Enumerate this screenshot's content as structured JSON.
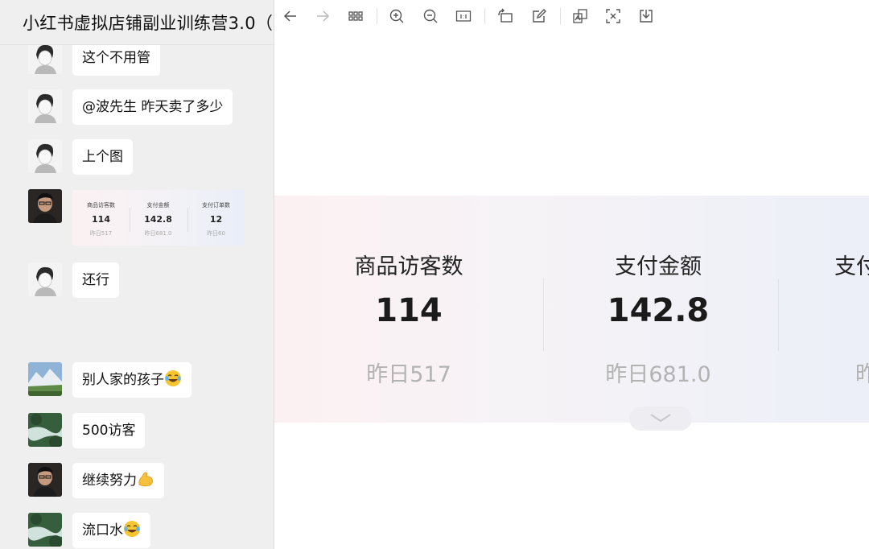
{
  "chat": {
    "title": "小红书虚拟店铺副业训练营3.0（",
    "messages": [
      {
        "text": "这个不用管",
        "avatar": "sketch-avatar"
      },
      {
        "text": "@波先生 昨天卖了多少",
        "avatar": "sketch-avatar"
      },
      {
        "text": "上个图",
        "avatar": "sketch-avatar"
      },
      {
        "text": "还行",
        "avatar": "sketch-avatar"
      },
      {
        "text": "别人家的孩子",
        "emoji": "tears-of-joy-emoji",
        "avatar": "mountain-avatar"
      },
      {
        "text": "500访客",
        "avatar": "river-avatar"
      },
      {
        "text": "继续努力",
        "emoji": "flexed-biceps-emoji",
        "avatar": "photo-avatar"
      },
      {
        "text": "流口水",
        "emoji": "tears-of-joy-emoji",
        "avatar": "river-avatar"
      }
    ],
    "image_message": {
      "avatar": "photo-avatar",
      "stats": [
        {
          "label": "商品访客数",
          "value": "114",
          "sub": "昨日517"
        },
        {
          "label": "支付金额",
          "value": "142.8",
          "sub": "昨日681.0"
        },
        {
          "label": "支付订单数",
          "value": "12",
          "sub": "昨日60"
        }
      ]
    }
  },
  "viewer": {
    "toolbar": [
      {
        "name": "back-arrow-icon"
      },
      {
        "name": "forward-arrow-icon"
      },
      {
        "name": "grid-view-icon"
      },
      {
        "name": "zoom-in-icon"
      },
      {
        "name": "zoom-out-icon"
      },
      {
        "name": "actual-size-icon"
      },
      {
        "name": "rotate-icon"
      },
      {
        "name": "edit-icon"
      },
      {
        "name": "translate-icon"
      },
      {
        "name": "ocr-scan-icon"
      },
      {
        "name": "download-icon"
      }
    ],
    "stats": [
      {
        "label": "商品访客数",
        "value": "114",
        "sub": "昨日517"
      },
      {
        "label": "支付金额",
        "value": "142.8",
        "sub": "昨日681.0"
      },
      {
        "label": "支付",
        "value": "",
        "sub": "昨"
      }
    ]
  },
  "colors": {
    "panel_bg": "#efefef",
    "bubble_bg": "#ffffff",
    "stats_gradient_start": "#fcf1f2",
    "stats_gradient_end": "#eceff8"
  }
}
